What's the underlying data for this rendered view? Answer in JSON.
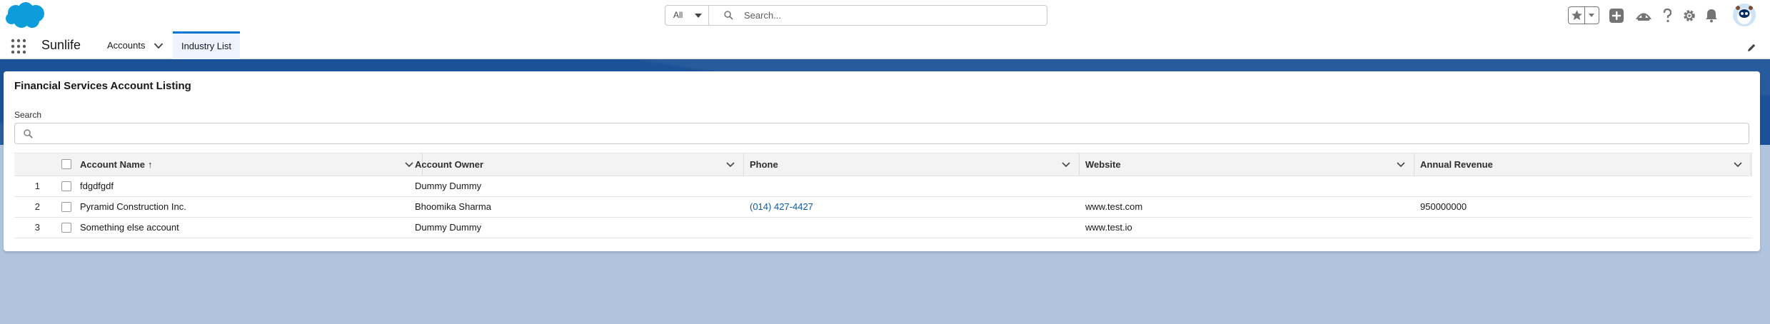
{
  "global_header": {
    "search_scope": "All",
    "search_placeholder": "Search..."
  },
  "nav": {
    "app_name": "Sunlife",
    "items": [
      {
        "label": "Accounts"
      },
      {
        "label": "Industry List"
      }
    ]
  },
  "card": {
    "title": "Financial Services Account Listing",
    "search_label": "Search"
  },
  "table": {
    "columns": [
      "Account Name",
      "Account Owner",
      "Phone",
      "Website",
      "Annual Revenue"
    ],
    "sort_indicator": "↑",
    "rows": [
      {
        "num": "1",
        "account_name": "fdgdfgdf",
        "account_owner": "Dummy Dummy",
        "phone": "",
        "website": "",
        "annual_revenue": ""
      },
      {
        "num": "2",
        "account_name": "Pyramid Construction Inc.",
        "account_owner": "Bhoomika Sharma",
        "phone": "(014) 427-4427",
        "website": "www.test.com",
        "annual_revenue": "950000000"
      },
      {
        "num": "3",
        "account_name": "Something else account",
        "account_owner": "Dummy Dummy",
        "phone": "",
        "website": "www.test.io",
        "annual_revenue": ""
      }
    ]
  },
  "colors": {
    "brand_blue": "#0176d3",
    "band_blue": "#1b5297",
    "background": "#b0c4df",
    "link": "#0b5cab"
  }
}
